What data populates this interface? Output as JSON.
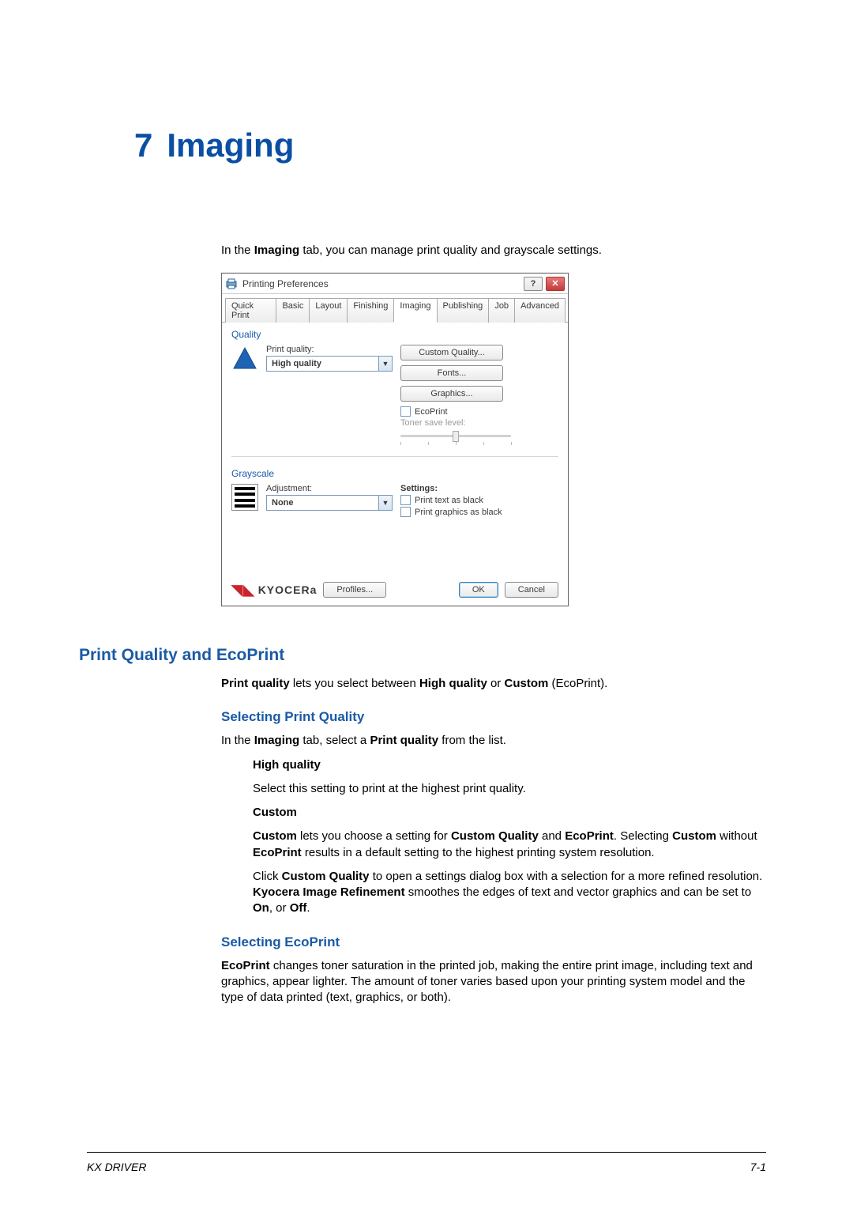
{
  "chapter": {
    "num": "7",
    "title": "Imaging"
  },
  "intro": {
    "pre": "In the ",
    "b1": "Imaging",
    "post": " tab, you can manage print quality and grayscale settings."
  },
  "dialog": {
    "title": "Printing Preferences",
    "help_glyph": "?",
    "close_glyph": "✕",
    "tabs": [
      "Quick Print",
      "Basic",
      "Layout",
      "Finishing",
      "Imaging",
      "Publishing",
      "Job",
      "Advanced"
    ],
    "active_tab_index": 4,
    "quality": {
      "section": "Quality",
      "label": "Print quality:",
      "value": "High quality",
      "buttons": [
        "Custom Quality...",
        "Fonts...",
        "Graphics..."
      ],
      "ecoprint": "EcoPrint",
      "toner_label": "Toner save level:"
    },
    "grayscale": {
      "section": "Grayscale",
      "label": "Adjustment:",
      "value": "None",
      "settings_label": "Settings:",
      "opts": [
        "Print text as black",
        "Print graphics as black"
      ]
    },
    "brand": "KYOCERa",
    "profiles": "Profiles...",
    "ok": "OK",
    "cancel": "Cancel"
  },
  "sections": {
    "h_pq": "Print Quality and EcoPrint",
    "pq_intro": {
      "pre": "Print quality",
      "mid": " lets you select between ",
      "b2": "High quality",
      "mid2": " or ",
      "b3": "Custom",
      "post": " (EcoPrint)."
    },
    "h_spq": "Selecting Print Quality",
    "spq_intro": {
      "pre": "In the ",
      "b1": "Imaging",
      "mid": " tab, select a ",
      "b2": "Print quality",
      "post": " from the list."
    },
    "hq_title": "High quality",
    "hq_body": "Select this setting to print at the highest print quality.",
    "cu_title": "Custom",
    "cu_p1": {
      "b1": "Custom",
      "t1": " lets you choose a setting for ",
      "b2": "Custom Quality",
      "t2": " and ",
      "b3": "EcoPrint",
      "t3": ". Selecting ",
      "b4": "Custom",
      "t4": " without ",
      "b5": "EcoPrint",
      "t5": " results in a default setting to the highest printing system resolution."
    },
    "cu_p2": {
      "t0": "Click ",
      "b1": "Custom Quality",
      "t1": " to open a settings dialog box with a selection for a more refined resolution. ",
      "b2": "Kyocera Image Refinement",
      "t2": " smoothes the edges of text and vector graphics and can be set to ",
      "b3": "On",
      "t3": ", or ",
      "b4": "Off",
      "t4": "."
    },
    "h_se": "Selecting EcoPrint",
    "se_p": {
      "b1": "EcoPrint",
      "t1": " changes toner saturation in the printed job, making the entire print image, including text and graphics, appear lighter. The amount of toner varies based upon your printing system model and the type of data printed (text, graphics, or both)."
    }
  },
  "footer": {
    "left": "KX DRIVER",
    "right": "7-1"
  }
}
